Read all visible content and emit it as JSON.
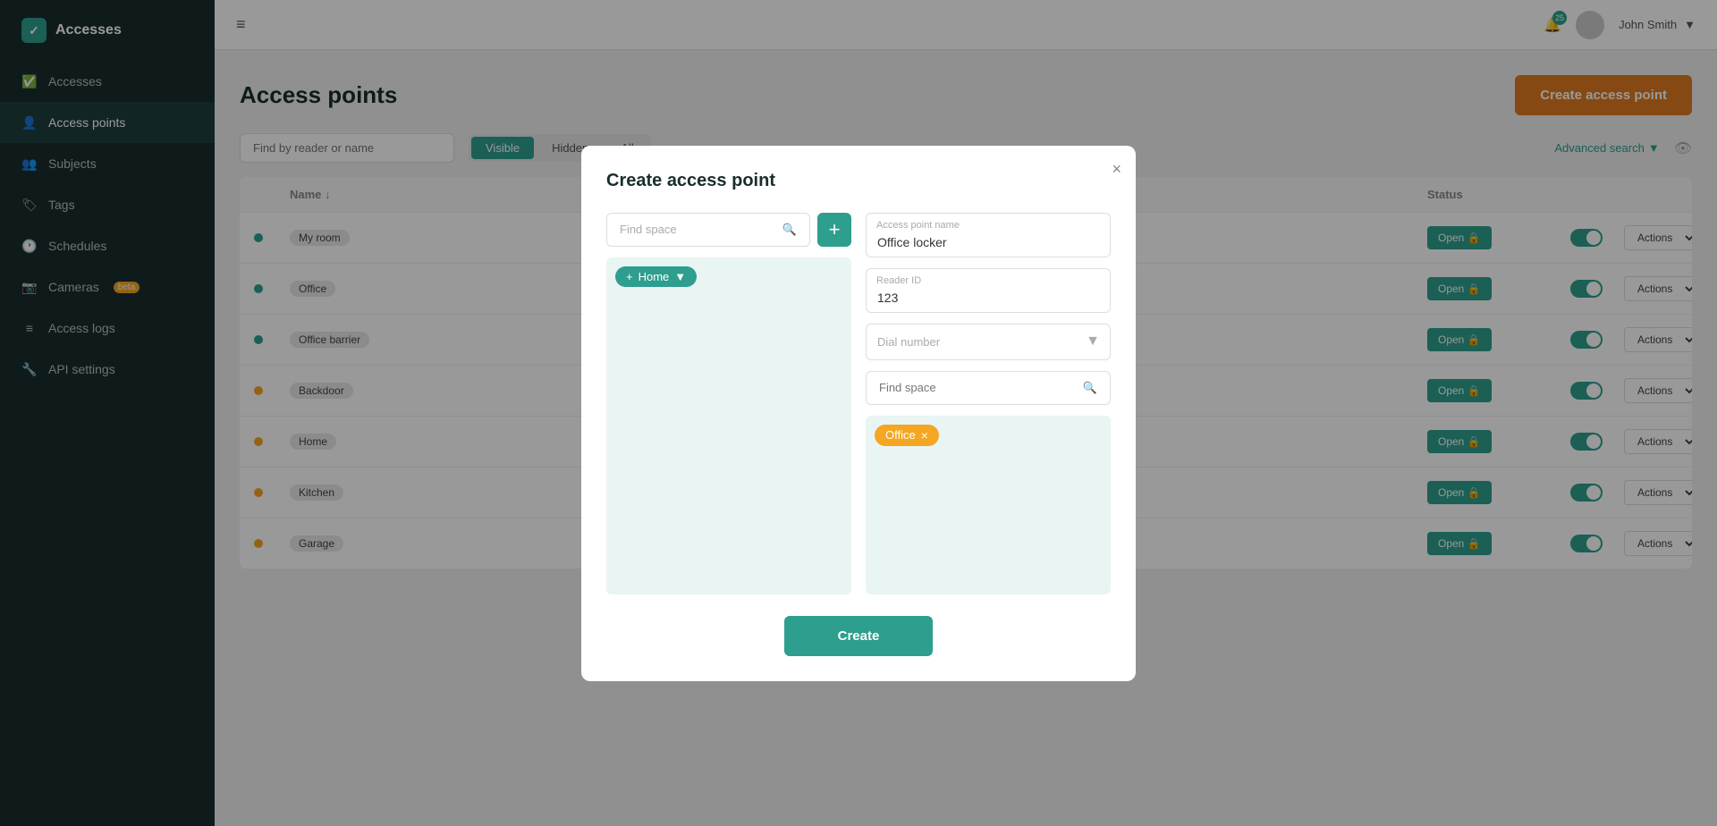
{
  "sidebar": {
    "items": [
      {
        "id": "accesses",
        "label": "Accesses",
        "icon": "✓",
        "active": false
      },
      {
        "id": "access-points",
        "label": "Access points",
        "icon": "👤",
        "active": true
      },
      {
        "id": "subjects",
        "label": "Subjects",
        "icon": "👥",
        "active": false
      },
      {
        "id": "tags",
        "label": "Tags",
        "icon": "🏷",
        "active": false
      },
      {
        "id": "schedules",
        "label": "Schedules",
        "icon": "🕐",
        "active": false
      },
      {
        "id": "cameras",
        "label": "Cameras",
        "badge": "beta",
        "icon": "📷",
        "active": false
      },
      {
        "id": "access-logs",
        "label": "Access logs",
        "icon": "≡",
        "active": false
      },
      {
        "id": "api-settings",
        "label": "API settings",
        "icon": "🔧",
        "active": false
      }
    ]
  },
  "topbar": {
    "hamburger": "≡",
    "notifications_count": "25",
    "user_name": "John Smith",
    "dropdown_arrow": "▼"
  },
  "page": {
    "title": "Access points",
    "create_button": "Create access point",
    "search_placeholder": "Find by reader or name",
    "advanced_search": "Advanced search",
    "tabs": [
      {
        "label": "Visible",
        "active": true
      },
      {
        "label": "Hidden",
        "active": false
      },
      {
        "label": "All",
        "active": false
      }
    ],
    "table": {
      "columns": [
        "",
        "Name",
        "",
        "",
        "",
        "Status",
        "",
        ""
      ],
      "rows": [
        {
          "dot": "green",
          "name": "My room",
          "status_btn": "Open 🔒",
          "toggle": true,
          "actions": "Actions"
        },
        {
          "dot": "green",
          "name": "Office",
          "status_btn": "Open 🔒",
          "toggle": true,
          "actions": "Actions"
        },
        {
          "dot": "green",
          "name": "Office barrier",
          "status_btn": "Open 🔒",
          "toggle": true,
          "actions": "Actions"
        },
        {
          "dot": "yellow",
          "name": "Backdoor",
          "status_btn": "Open 🔒",
          "toggle": true,
          "actions": "Actions"
        },
        {
          "dot": "yellow",
          "name": "Home",
          "status_btn": "Open 🔒",
          "toggle": true,
          "actions": "Actions"
        },
        {
          "dot": "yellow",
          "name": "Kitchen",
          "status_btn": "Open 🔒",
          "toggle": true,
          "actions": "Actions"
        },
        {
          "dot": "yellow",
          "name": "Garage",
          "status_btn": "Open 🔒",
          "toggle": true,
          "actions": "Actions"
        }
      ]
    }
  },
  "modal": {
    "title": "Create access point",
    "close_label": "×",
    "left": {
      "find_space_placeholder": "Find space",
      "add_btn_label": "+",
      "home_chip_label": "Home",
      "home_chip_plus": "+"
    },
    "right": {
      "access_point_name_label": "Access point name",
      "access_point_name_value": "Office locker",
      "reader_id_label": "Reader ID",
      "reader_id_value": "123",
      "dial_number_placeholder": "Dial number",
      "find_space_placeholder": "Find space",
      "office_chip_label": "Office",
      "office_chip_close": "×"
    },
    "create_button": "Create"
  }
}
